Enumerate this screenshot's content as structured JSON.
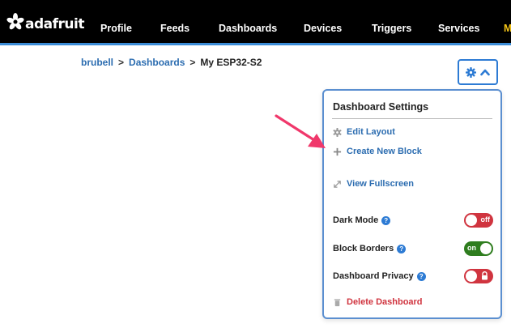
{
  "nav": {
    "logo_text": "adafruit",
    "items": [
      "Profile",
      "Feeds",
      "Dashboards",
      "Devices",
      "Triggers",
      "Services"
    ],
    "cut_item": "M"
  },
  "breadcrumb": {
    "user": "brubell",
    "section": "Dashboards",
    "separator": ">",
    "current": "My ESP32-S2"
  },
  "settings_button": {
    "icons": [
      "gear-icon",
      "chevron-up-icon"
    ],
    "accent": "#2d7bd4"
  },
  "panel": {
    "title": "Dashboard Settings",
    "edit_layout": "Edit Layout",
    "create_block": "Create New Block",
    "view_fullscreen": "View Fullscreen",
    "delete_dashboard": "Delete Dashboard",
    "dark_mode": {
      "label": "Dark Mode",
      "state": "off"
    },
    "block_borders": {
      "label": "Block Borders",
      "state": "on"
    },
    "privacy": {
      "label": "Dashboard Privacy",
      "state": "locked"
    }
  },
  "colors": {
    "link": "#2b6cb0",
    "danger": "#d0343f",
    "toggle_on": "#2e7d1e",
    "toggle_off": "#d0343f",
    "arrow": "#f0386b",
    "nav_bg": "#000000",
    "nav_accent": "#3b8cd6"
  }
}
